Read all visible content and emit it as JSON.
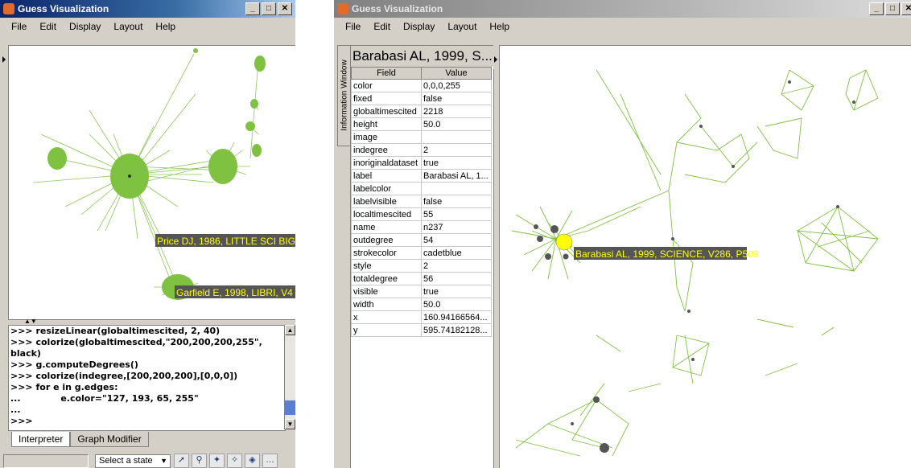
{
  "left_window": {
    "title": "Guess Visualization",
    "window_buttons": [
      "_",
      "□",
      "✕"
    ],
    "menus": [
      "File",
      "Edit",
      "Display",
      "Layout",
      "Help"
    ],
    "graph_labels": [
      "Price DJ, 1986, LITTLE SCI BIG",
      "Garfield E, 1998, LIBRI, V4"
    ],
    "console_lines": [
      ">>> resizeLinear(globaltimescited, 2, 40)",
      ">>> colorize(globaltimescited,\"200,200,200,255\",",
      "black)",
      ">>> g.computeDegrees()",
      ">>> colorize(indegree,[200,200,200],[0,0,0])",
      ">>> for e in g.edges:",
      "...             e.color=\"127, 193, 65, 255\"",
      "...",
      ">>>"
    ],
    "tabs": [
      "Interpreter",
      "Graph Modifier"
    ],
    "select_state": "Select a state",
    "tool_icons": [
      "pointer-icon",
      "zoom-icon",
      "node-edit-icon",
      "edge-edit-icon",
      "layout-icon",
      "more-icon"
    ]
  },
  "right_window": {
    "title": "Guess Visualization",
    "window_buttons": [
      "_",
      "□",
      "✕"
    ],
    "menus": [
      "File",
      "Edit",
      "Display",
      "Layout",
      "Help"
    ],
    "info_tab_label": "Information Window",
    "info_title": "Barabasi AL, 1999, S...",
    "table_headers": [
      "Field",
      "Value"
    ],
    "rows": [
      [
        "color",
        "0,0,0,255"
      ],
      [
        "fixed",
        "false"
      ],
      [
        "globaltimescited",
        "2218"
      ],
      [
        "height",
        "50.0"
      ],
      [
        "image",
        ""
      ],
      [
        "indegree",
        "2"
      ],
      [
        "inoriginaldataset",
        "true"
      ],
      [
        "label",
        "Barabasi AL, 1..."
      ],
      [
        "labelcolor",
        ""
      ],
      [
        "labelvisible",
        "false"
      ],
      [
        "localtimescited",
        "55"
      ],
      [
        "name",
        "n237"
      ],
      [
        "outdegree",
        "54"
      ],
      [
        "strokecolor",
        "cadetblue"
      ],
      [
        "style",
        "2"
      ],
      [
        "totaldegree",
        "56"
      ],
      [
        "visible",
        "true"
      ],
      [
        "width",
        "50.0"
      ],
      [
        "x",
        "160.94166564..."
      ],
      [
        "y",
        "595.74182128..."
      ]
    ],
    "graph_label": "Barabasi AL, 1999, SCIENCE, V286, P509"
  },
  "colors": {
    "edge": "#7fc141",
    "node": "#555555",
    "label_bg": "#555555",
    "label_text": "#ffff00",
    "highlight_node": "#ffff00"
  }
}
